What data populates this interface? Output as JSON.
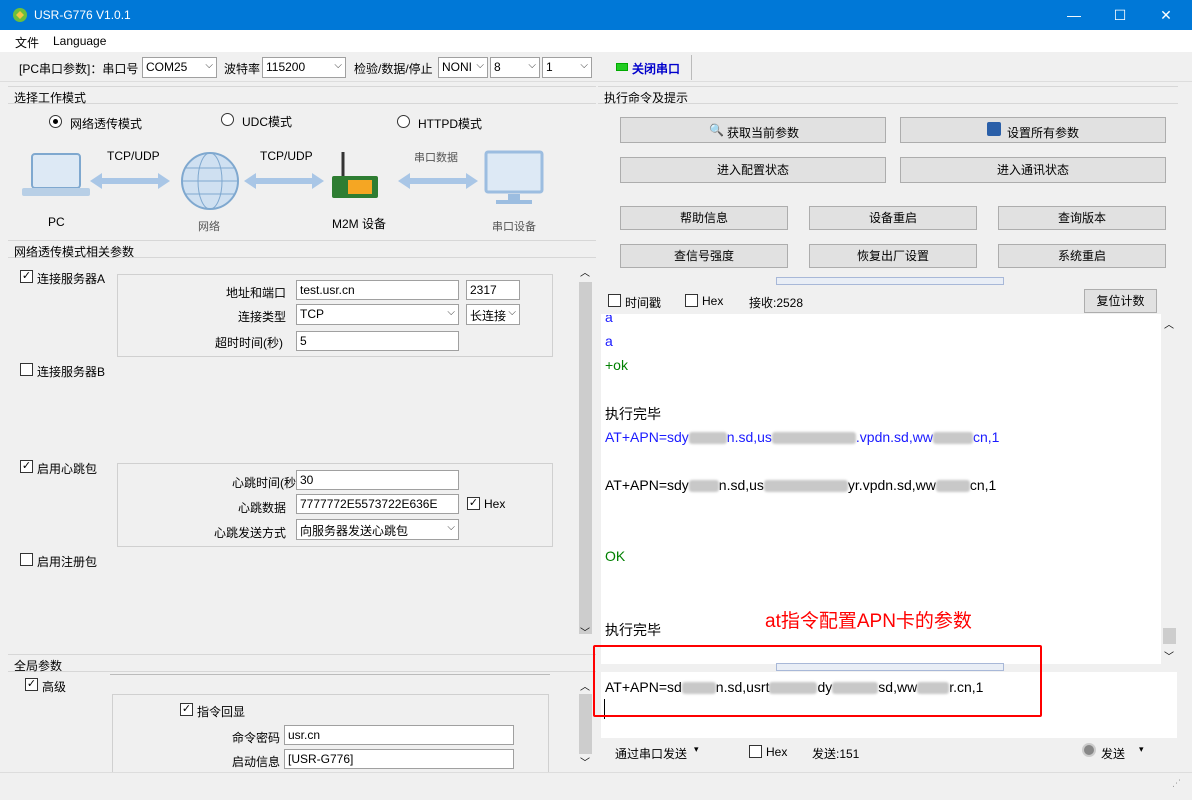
{
  "window": {
    "title": "USR-G776 V1.0.1",
    "minimize": "—",
    "maximize": "☐",
    "close": "✕"
  },
  "menu": {
    "file": "文件",
    "language": "Language"
  },
  "serial": {
    "prefix": "[PC串口参数]：串口号",
    "port": "COM25",
    "baud_label": "波特率",
    "baud": "115200",
    "check_label": "检验/数据/停止",
    "parity": "NONI",
    "databits": "8",
    "stopbits": "1",
    "close_button": "关闭串口"
  },
  "left": {
    "mode_header": "选择工作模式",
    "modes": [
      "网络透传模式",
      "UDC模式",
      "HTTPD模式"
    ],
    "diagram": {
      "pc": "PC",
      "tcp1": "TCP/UDP",
      "net": "网络",
      "tcp2": "TCP/UDP",
      "m2m": "M2M 设备",
      "serial_data": "串口数据",
      "serial_device": "串口设备"
    },
    "params_header": "网络透传模式相关参数",
    "serverA": {
      "label": "连接服务器A",
      "addr_label": "地址和端口",
      "addr": "test.usr.cn",
      "port": "2317",
      "type_label": "连接类型",
      "type": "TCP",
      "conn": "长连接",
      "timeout_label": "超时时间(秒)",
      "timeout": "5"
    },
    "serverB": {
      "label": "连接服务器B"
    },
    "heartbeat": {
      "label": "启用心跳包",
      "time_label": "心跳时间(秒",
      "time": "30",
      "data_label": "心跳数据",
      "data": "7777772E5573722E636E",
      "hex": "Hex",
      "mode_label": "心跳发送方式",
      "mode": "向服务器发送心跳包"
    },
    "register": {
      "label": "启用注册包"
    },
    "global_header": "全局参数",
    "advanced": "高级",
    "echo": "指令回显",
    "cmd_pwd_label": "命令密码",
    "cmd_pwd": "usr.cn",
    "boot_info_label": "启动信息",
    "boot_info": "[USR-G776]"
  },
  "right": {
    "header": "执行命令及提示",
    "buttons": {
      "get_params": "获取当前参数",
      "set_params": "设置所有参数",
      "enter_config": "进入配置状态",
      "enter_comm": "进入通讯状态",
      "help": "帮助信息",
      "restart_dev": "设备重启",
      "query_ver": "查询版本",
      "signal": "查信号强度",
      "factory": "恢复出厂设置",
      "sys_restart": "系统重启"
    },
    "timestamp": "时间戳",
    "hex": "Hex",
    "recv": "接收:2528",
    "reset_count": "复位计数",
    "console": {
      "l1": "a",
      "l2": "a",
      "l3": "+ok",
      "l4": "执行完毕",
      "l5a": "AT+APN=sdy",
      "l5b": "n.sd,us",
      "l5c": ".vpdn.sd,ww",
      "l5d": "cn,1",
      "l6a": "AT+APN=sdy",
      "l6b": "n.sd,us",
      "l6c": "yr.vpdn.sd,ww",
      "l6d": "cn,1",
      "l7": "OK",
      "l8": "执行完毕"
    },
    "annotation": "at指令配置APN卡的参数",
    "send_text": {
      "a": "AT+APN=sd",
      "b": "n.sd,usrt",
      "c": "dy",
      "d": "sd,ww",
      "e": "r.cn,1"
    },
    "send_mode": "通过串口发送",
    "send_hex": "Hex",
    "sent": "发送:151",
    "send_button": "发送"
  },
  "colors": {
    "accent": "#0078d7",
    "blue_text": "#1a1aff",
    "green_text": "#008000",
    "red": "#ff0000"
  }
}
